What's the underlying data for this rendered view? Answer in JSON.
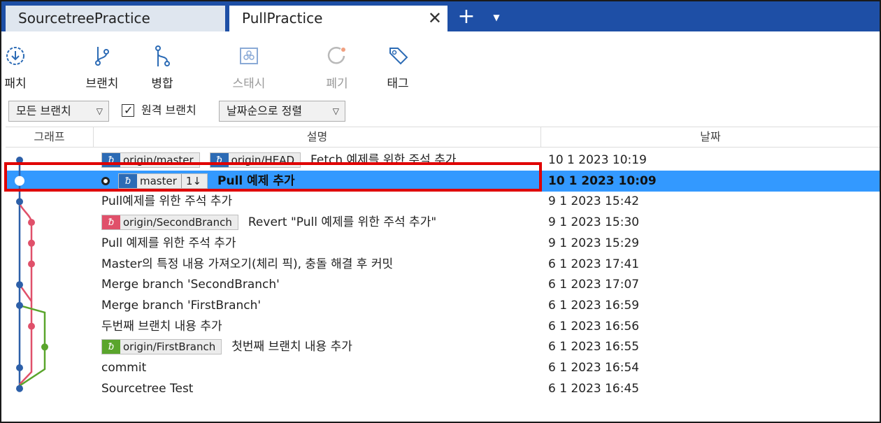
{
  "tabs": [
    {
      "label": "SourcetreePractice",
      "active": false
    },
    {
      "label": "PullPractice",
      "active": true
    }
  ],
  "tab_close_glyph": "✕",
  "tab_add_glyph": "+",
  "toolbar": {
    "fetch_label": "패치",
    "branch_label": "브랜치",
    "merge_label": "병합",
    "stash_label": "스태시",
    "discard_label": "폐기",
    "tag_label": "태그"
  },
  "filters": {
    "branch_filter_value": "모든 브랜치",
    "remote_branches_label": "원격 브랜치",
    "remote_branches_checked": true,
    "sort_value": "날짜순으로 정렬"
  },
  "columns": {
    "graph": "그래프",
    "description": "설명",
    "date": "날짜"
  },
  "commits": [
    {
      "badges": [
        {
          "name": "origin/master",
          "color": "blue"
        },
        {
          "name": "origin/HEAD",
          "color": "blue"
        }
      ],
      "message": "Fetch 예제를 위한 주석 추가",
      "date": "10 1 2023 10:19"
    },
    {
      "badges": [
        {
          "name": "master",
          "color": "blue",
          "ahead": "1↓"
        }
      ],
      "message": "Pull 예제 추가",
      "date": "10 1 2023 10:09",
      "selected": true,
      "head": true
    },
    {
      "badges": [],
      "message": "Pull예제를 위한 주석 추가",
      "date": "9 1 2023 15:42"
    },
    {
      "badges": [
        {
          "name": "origin/SecondBranch",
          "color": "red"
        }
      ],
      "message": "Revert \"Pull 예제를 위한 주석 추가\"",
      "date": "9 1 2023 15:30"
    },
    {
      "badges": [],
      "message": "Pull 예제를 위한 주석 추가",
      "date": "9 1 2023 15:29"
    },
    {
      "badges": [],
      "message": "Master의 특정 내용 가져오기(체리 픽), 충돌 해결 후 커밋",
      "date": "6 1 2023 17:41"
    },
    {
      "badges": [],
      "message": "Merge branch 'SecondBranch'",
      "date": "6 1 2023 17:07"
    },
    {
      "badges": [],
      "message": "Merge branch 'FirstBranch'",
      "date": "6 1 2023 16:59"
    },
    {
      "badges": [],
      "message": "두번째 브랜치 내용 추가",
      "date": "6 1 2023 16:56"
    },
    {
      "badges": [
        {
          "name": "origin/FirstBranch",
          "color": "green"
        }
      ],
      "message": "첫번째 브랜치 내용 추가",
      "date": "6 1 2023 16:55"
    },
    {
      "badges": [],
      "message": "commit",
      "date": "6 1 2023 16:54"
    },
    {
      "badges": [],
      "message": "Sourcetree Test",
      "date": "6 1 2023 16:45"
    }
  ],
  "colors": {
    "tabbar": "#1e4fa6",
    "selection": "#3399ff",
    "graph_master": "#2c5fa8",
    "graph_second": "#e0506a",
    "graph_first": "#5aa52c",
    "annotation_box": "#e00000"
  }
}
